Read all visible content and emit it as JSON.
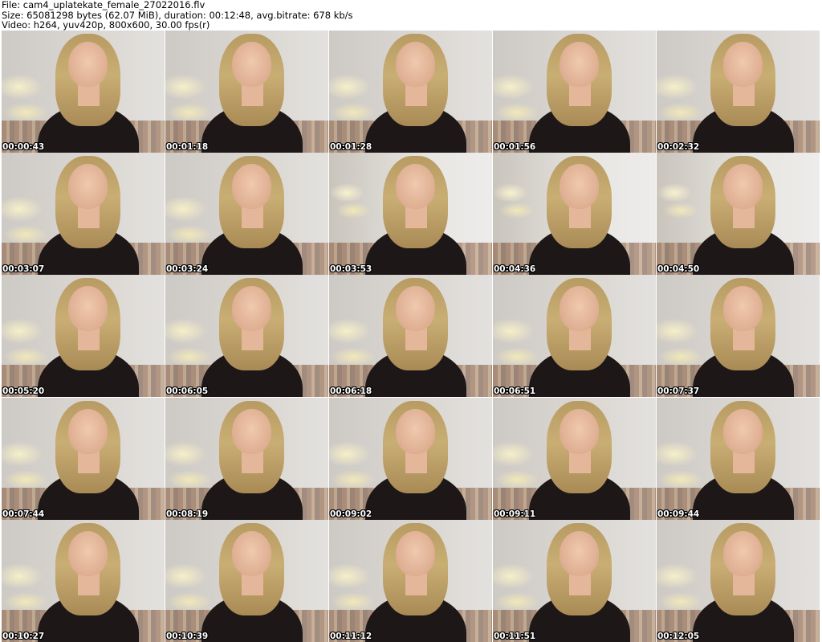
{
  "header": {
    "file_line": "File: cam4_uplatekate_female_27022016.flv",
    "size_line": "Size: 65081298 bytes (62.07 MiB), duration: 00:12:48, avg.bitrate: 678 kb/s",
    "video_line": "Video: h264, yuv420p, 800x600, 30.00 fps(r)"
  },
  "thumbnails": [
    {
      "timestamp": "00:00:43"
    },
    {
      "timestamp": "00:01:18"
    },
    {
      "timestamp": "00:01:28"
    },
    {
      "timestamp": "00:01:56"
    },
    {
      "timestamp": "00:02:32"
    },
    {
      "timestamp": "00:03:07"
    },
    {
      "timestamp": "00:03:24"
    },
    {
      "timestamp": "00:03:53"
    },
    {
      "timestamp": "00:04:36"
    },
    {
      "timestamp": "00:04:50"
    },
    {
      "timestamp": "00:05:20"
    },
    {
      "timestamp": "00:06:05"
    },
    {
      "timestamp": "00:06:18"
    },
    {
      "timestamp": "00:06:51"
    },
    {
      "timestamp": "00:07:37"
    },
    {
      "timestamp": "00:07:44"
    },
    {
      "timestamp": "00:08:19"
    },
    {
      "timestamp": "00:09:02"
    },
    {
      "timestamp": "00:09:11"
    },
    {
      "timestamp": "00:09:44"
    },
    {
      "timestamp": "00:10:27"
    },
    {
      "timestamp": "00:10:39"
    },
    {
      "timestamp": "00:11:12"
    },
    {
      "timestamp": "00:11:51"
    },
    {
      "timestamp": "00:12:05"
    }
  ]
}
